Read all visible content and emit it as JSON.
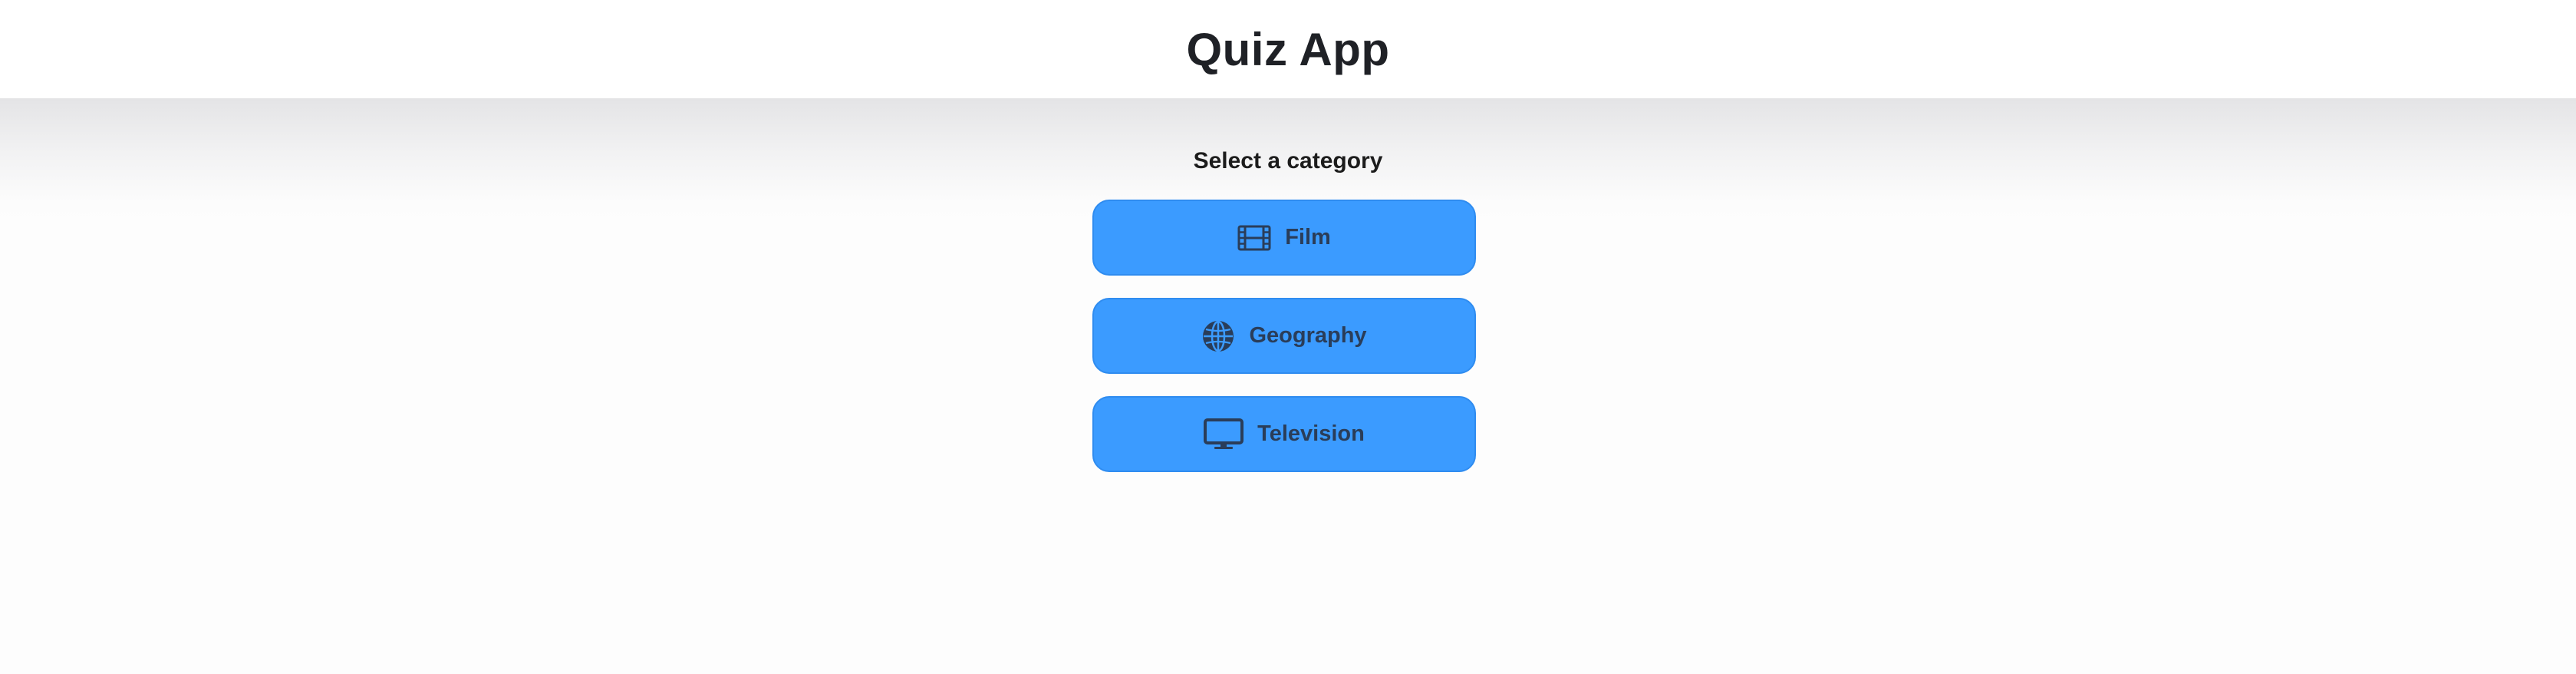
{
  "header": {
    "title": "Quiz App"
  },
  "main": {
    "prompt": "Select a category",
    "categories": [
      {
        "label": "Film",
        "icon": "film-icon"
      },
      {
        "label": "Geography",
        "icon": "globe-icon"
      },
      {
        "label": "Television",
        "icon": "television-icon"
      }
    ]
  },
  "colors": {
    "button": "#3b9bff",
    "button_text": "#2a3d59",
    "title": "#1f2126"
  }
}
